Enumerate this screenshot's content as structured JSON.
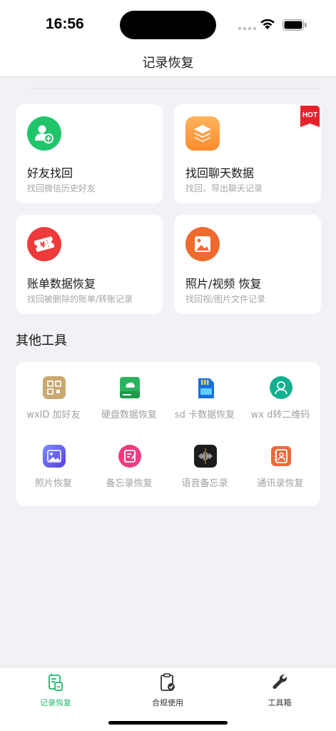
{
  "status": {
    "time": "16:56"
  },
  "nav": {
    "title": "记录恢复"
  },
  "cards": [
    {
      "title": "好友找回",
      "sub": "找回微信历史好友",
      "icon": "add-friend-icon",
      "color": "#20c56b"
    },
    {
      "title": "找回聊天数据",
      "sub": "找回、导出聊天记录",
      "icon": "layers-icon",
      "color": "#fb9a3c",
      "badge": "HOT"
    },
    {
      "title": "账单数据恢复",
      "sub": "找回被删除的账单/转账记录",
      "icon": "bill-icon",
      "color": "#ee3a3a"
    },
    {
      "title": "照片/视频 恢复",
      "sub": "找回视/图片文件记录",
      "icon": "photo-icon",
      "color": "#ee6a2e"
    }
  ],
  "section": {
    "title": "其他工具"
  },
  "tools": [
    {
      "label": "wxID 加好友",
      "icon": "qr-id-icon"
    },
    {
      "label": "硬盘数据恢复",
      "icon": "hard-disk-icon"
    },
    {
      "label": "sd 卡数据恢复",
      "icon": "sd-card-icon"
    },
    {
      "label": "wx d转二维码",
      "icon": "user-circle-icon"
    },
    {
      "label": "照片恢复",
      "icon": "image-icon"
    },
    {
      "label": "备忘录恢复",
      "icon": "memo-icon"
    },
    {
      "label": "语音备忘录",
      "icon": "voice-memo-icon"
    },
    {
      "label": "通讯录恢复",
      "icon": "contacts-icon"
    }
  ],
  "tabbar": {
    "items": [
      {
        "label": "记录恢复",
        "icon": "record-icon",
        "active": true
      },
      {
        "label": "合规使用",
        "icon": "clipboard-check-icon",
        "active": false
      },
      {
        "label": "工具箱",
        "icon": "wrench-icon",
        "active": false
      }
    ]
  },
  "colors": {
    "accent": "#1fb86a",
    "hot": "#e8222b"
  }
}
